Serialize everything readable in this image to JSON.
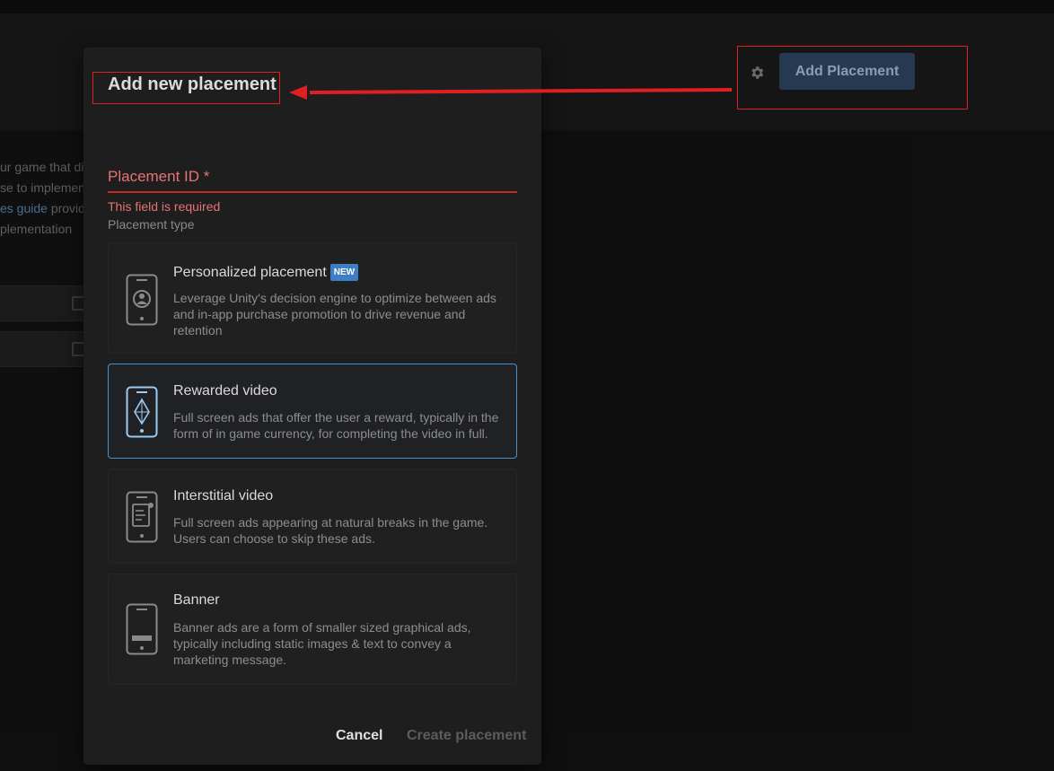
{
  "background": {
    "text_lines": [
      "ur game that dis",
      "se to implemen",
      "es guide",
      " provid",
      "plementation"
    ]
  },
  "header": {
    "add_placement_label": "Add Placement"
  },
  "modal": {
    "title": "Add new placement",
    "placement_id": {
      "label": "Placement ID *",
      "value": "",
      "error": "This field is required"
    },
    "placement_type_label": "Placement type",
    "options": [
      {
        "title": "Personalized placement",
        "badge": "NEW",
        "description": "Leverage Unity's decision engine to optimize between ads and in-app purchase promotion to drive revenue and retention",
        "icon": "phone-user-icon",
        "selected": false
      },
      {
        "title": "Rewarded video",
        "description": "Full screen ads that offer the user a reward, typically in the form of in game currency, for completing the video in full.",
        "icon": "phone-diamond-icon",
        "selected": true
      },
      {
        "title": "Interstitial video",
        "description": "Full screen ads appearing at natural breaks in the game. Users can choose to skip these ads.",
        "icon": "phone-document-icon",
        "selected": false
      },
      {
        "title": "Banner",
        "description": "Banner ads are a form of smaller sized graphical ads, typically including static images & text to convey a marketing message.",
        "icon": "phone-banner-icon",
        "selected": false
      }
    ],
    "cancel_label": "Cancel",
    "create_label": "Create placement"
  },
  "colors": {
    "error": "#e57373",
    "selected_border": "#4a90c8",
    "annotation": "#e02020",
    "primary_button": "#253a52"
  }
}
